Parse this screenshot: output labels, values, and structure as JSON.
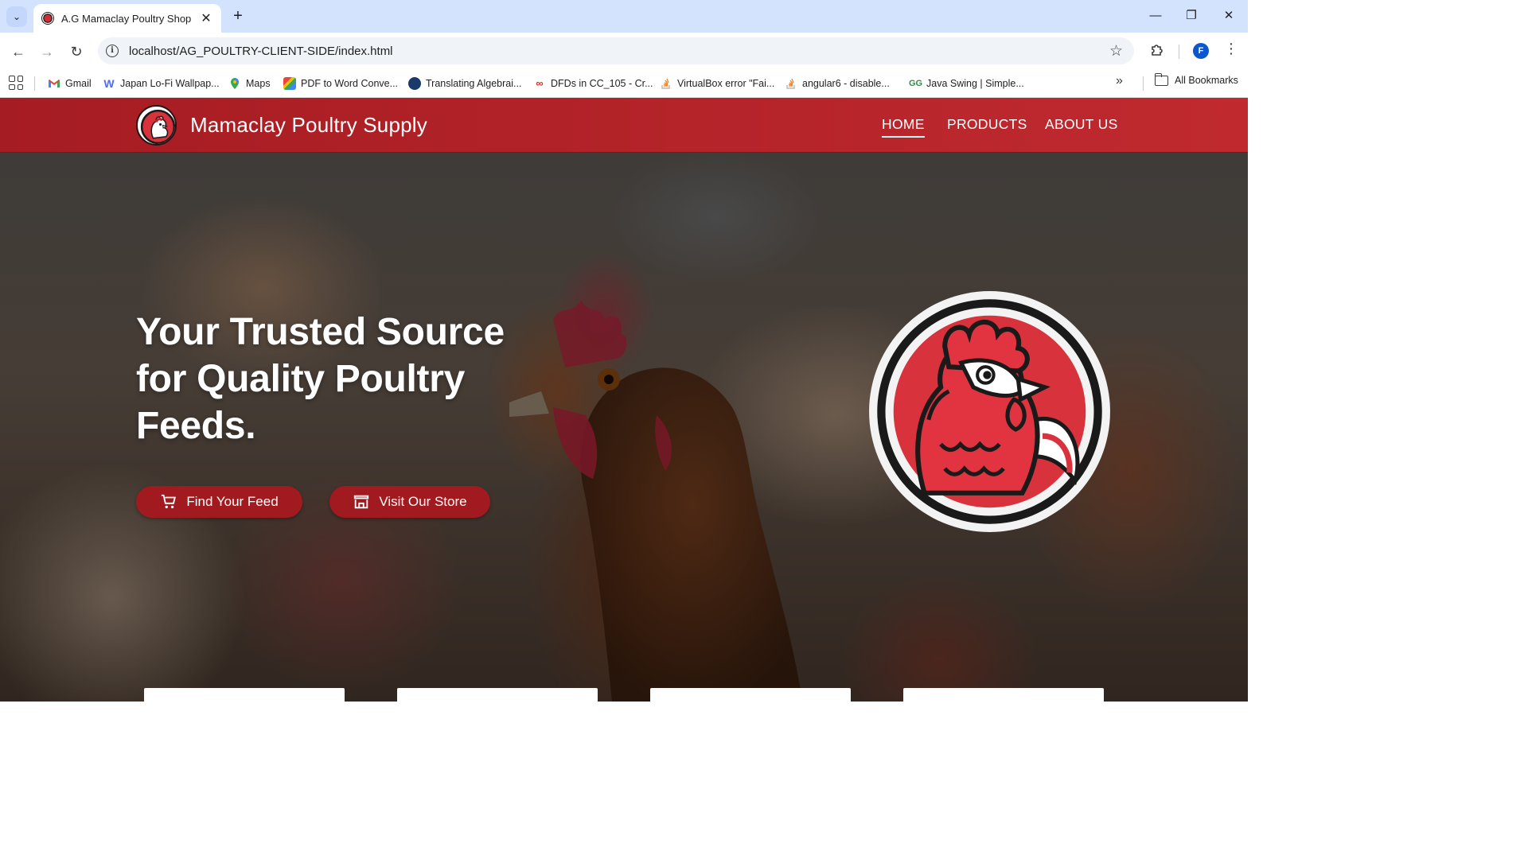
{
  "browser": {
    "tab_title": "A.G Mamaclay Poultry Shop",
    "url": "localhost/AG_POULTRY-CLIENT-SIDE/index.html",
    "profile_initial": "F",
    "bookmarks": [
      {
        "label": "Gmail",
        "icon": "gmail-icon",
        "color": "#ea4335"
      },
      {
        "label": "Japan Lo-Fi Wallpap...",
        "icon": "wallpaper-site-icon",
        "color": "#4a6cf7"
      },
      {
        "label": "Maps",
        "icon": "maps-icon",
        "color": "#34a853"
      },
      {
        "label": "PDF to Word Conve...",
        "icon": "pdf-converter-icon",
        "color": "#e8453c"
      },
      {
        "label": "Translating Algebrai...",
        "icon": "translate-site-icon",
        "color": "#1a3a6b"
      },
      {
        "label": "DFDs in CC_105 - Cr...",
        "icon": "dfd-site-icon",
        "color": "#d93025"
      },
      {
        "label": "VirtualBox error \"Fai...",
        "icon": "stackoverflow-icon",
        "color": "#f48024"
      },
      {
        "label": "angular6 - disable...",
        "icon": "stackoverflow-icon",
        "color": "#f48024"
      },
      {
        "label": "Java Swing | Simple...",
        "icon": "geeksforgeeks-icon",
        "color": "#2f8d46"
      }
    ],
    "all_bookmarks_label": "All Bookmarks"
  },
  "site": {
    "brand": "Mamaclay Poultry Supply",
    "nav": [
      "HOME",
      "PRODUCTS",
      "ABOUT US"
    ],
    "active_nav": "HOME",
    "hero_title": "Your Trusted Source for Quality Poultry Feeds.",
    "buttons": {
      "find_feed": "Find Your Feed",
      "visit_store": "Visit Our Store"
    },
    "colors": {
      "brand_red": "#a51c22",
      "button_red": "#a11a1f"
    }
  }
}
